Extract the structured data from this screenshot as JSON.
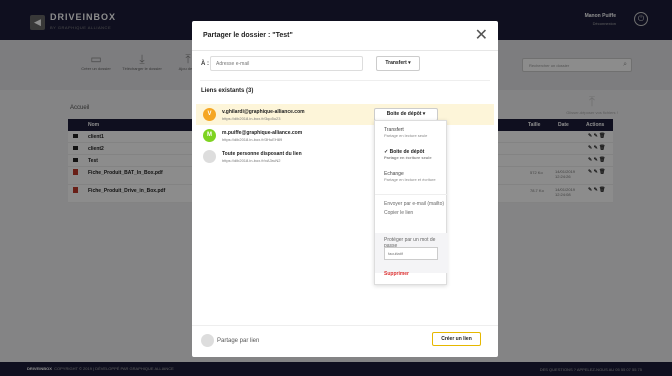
{
  "app": {
    "brand": "DRIVEINBOX",
    "brand_sub": "BY GRAPHIQUE ALLIANCE",
    "user_name": "Manon Puiffe",
    "user_action": "Déconnexion",
    "toolbar": [
      {
        "label": "Créer un dossier",
        "icon": "folder-add-icon"
      },
      {
        "label": "Télécharger le dossier",
        "icon": "download-icon"
      },
      {
        "label": "Ajou des fi",
        "icon": "upload-icon"
      }
    ],
    "search_placeholder": "Rechercher un dossier",
    "breadcrumb": "Accueil",
    "drop_hint": "Glisser-déposer vos fichiers !",
    "table": {
      "headers": {
        "name": "Nom",
        "size": "Taille",
        "date": "Date",
        "actions": "Actions"
      },
      "rows": [
        {
          "name": "client1",
          "type": "folder",
          "size": "",
          "date": "",
          "time": ""
        },
        {
          "name": "client2",
          "type": "folder",
          "size": "",
          "date": "",
          "time": ""
        },
        {
          "name": "Test",
          "type": "folder",
          "size": "",
          "date": "",
          "time": ""
        },
        {
          "name": "Fiche_Produit_BAT_In_Box.pdf",
          "type": "pdf",
          "size": "572 Ko",
          "date": "14/01/2019",
          "time": "12:24:26"
        },
        {
          "name": "Fiche_Produit_Drive_in_Box.pdf",
          "type": "pdf",
          "size": "78.7 Ko",
          "date": "14/01/2019",
          "time": "12:24:08"
        }
      ],
      "actions_glyphs": "✎ ✎ 🗑"
    },
    "footer_brand": "DRIVEINBOX",
    "footer_left": "COPYRIGHT © 2019 | DÉVELOPPÉ PAR GRAPHIQUE ALLIANCE",
    "footer_right": "DES QUESTIONS ? APPELEZ-NOUS AU 05 55 07 55 75"
  },
  "modal": {
    "title": "Partager le dossier : \"Test\"",
    "to_label": "À :",
    "email_placeholder": "Adresse e-mail",
    "transfer_button": "Transfert ▾",
    "links_title": "Liens existants (3)",
    "links": [
      {
        "initial": "V",
        "color": "#f5a623",
        "name": "v.ghilardi@graphique-alliance.com",
        "url": "https://dib2018.in-box.fr/3qo5u23",
        "permission": "Boite de dépôt ▾"
      },
      {
        "initial": "M",
        "color": "#7ed321",
        "name": "m.puiffe@graphique-alliance.com",
        "url": "https://dib2018.in-box.fr/3HuEH89",
        "permission": ""
      },
      {
        "initial": "",
        "color": "#dddddd",
        "name": "Toute personne disposant du lien",
        "url": "https://dib2018.in-box.fr/xA3ruN2",
        "permission": ""
      }
    ],
    "dropdown": {
      "options": [
        {
          "label": "Transfert",
          "sub": "Partage en lecture seule"
        },
        {
          "label": "✓ Boite de dépôt",
          "sub": "Partage en écriture seule"
        },
        {
          "label": "Echange",
          "sub": "Partage en lecture et écriture"
        }
      ],
      "send_email": "Envoyer par e-mail (mailto)",
      "copy_link": "Copier le lien",
      "password_label": "Protéger par un mot de passe",
      "password_placeholder": "facultatif",
      "delete": "Supprimer"
    },
    "share_by_link": "Partage par lien",
    "create_link": "Créer un lien"
  }
}
